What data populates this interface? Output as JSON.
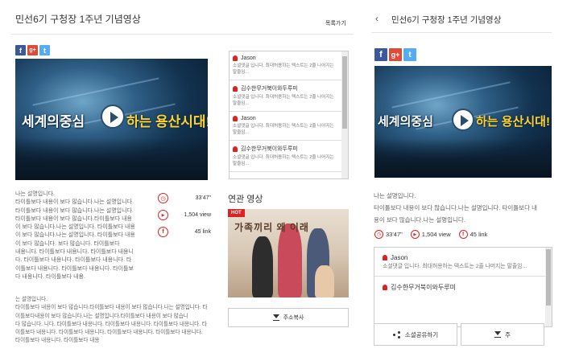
{
  "desktop": {
    "title": "민선6기 구청장 1주년 기념영상",
    "back_link": "목록가기",
    "sns": {
      "facebook": "f",
      "google": "g+",
      "twitter": "t"
    },
    "video": {
      "caption_left": "세계의중심",
      "caption_right": "하는 용산시대!"
    },
    "description_1": [
      "나는 설명입니다.",
      "타이틀보다 내용이 보다 많습니다.나는 설명입니다.",
      "타이틀보다 내용이 보다 많습니다.나는 설명입니다.",
      "타이틀보다 내용이 보다 많습니다.타이틀보다 내용",
      "이 보다 많습니다.나는 설명입니다. 타이틀보다 내용",
      "이 보다 많습니다.나는 설명입니다. 타이틀보다 내용",
      "이 보다 많습니다. 보다 많습니다. 타이틀보다",
      "내용니다. 타이틀보다 내용니다. 타이틀보다 내용니",
      "다. 타이틀보다 내용니다. 타이틀보다 내용니다. 타",
      "이틀보다 내용니다. 타이틀보다 내용니다. 타이틀보",
      "다 내용니다. 타이틀보다 내용."
    ],
    "description_2": [
      "는 설명입니다.",
      "타이틀보다 내용이 보다 많습니다.타이틀보다 내용이 보다 많습니다.나는 설명입니다. 타",
      "이틀보다내용이 보다 많습니다.나는 설명입니다.타이틀보다 내용이 보다 많습니",
      "다 많습니다. 니다. 타이틀보다 내용니다. 타이틀보다 내용니다. 타이틀보다 내용니다. 타",
      "이틀보다 내용니다. 타이틀보다 내용니다. 타이틀보다 내용니다. 타이틀보다 내용니다.",
      "타이틀보다 내용니다. 타이틀보다 내용"
    ],
    "stats": [
      {
        "icon": "clock-icon",
        "glyph": "◷",
        "value": "33'47\""
      },
      {
        "icon": "play-icon",
        "glyph": "▶",
        "value": "1,504 view"
      },
      {
        "icon": "facebook-icon",
        "glyph": "f",
        "value": "45 link"
      }
    ],
    "comments": [
      {
        "name": "Jason",
        "text": "소셜댓글 입니다. 최대허용하는 텍스트는 2줄 나어지는 말줄임..."
      },
      {
        "name": "김수한무거북이와두루미",
        "text": "소셜댓글 입니다. 최대허용하는 텍스트는 2줄 나어지는 말줄임..."
      },
      {
        "name": "Jason",
        "text": "소셜댓글 입니다. 최대허용하는 텍스트는 2줄 나어지는 말줄임..."
      },
      {
        "name": "김수한무거북이와두루미",
        "text": "소셜댓글 입니다. 최대허용하는 텍스트는 2줄 나어지는 말줄임..."
      }
    ],
    "related": {
      "title": "연관 영상",
      "badge": "HOT",
      "poster_title": "가족끼리 왜 이래"
    },
    "copy_address": "주소복사"
  },
  "mobile": {
    "back": "‹",
    "title": "민선6기 구청장 1주년 기념영상",
    "description": [
      "나는 설명입니다.",
      "타이틀보다 내용이 보다 많습니다.나는 설명입니다. 타이틀보다 내",
      "용이 보다 많습니다.나는 설명입니다."
    ],
    "stats": [
      {
        "icon": "clock-icon",
        "glyph": "◷",
        "value": "33'47\""
      },
      {
        "icon": "play-icon",
        "glyph": "▶",
        "value": "1,504 view"
      },
      {
        "icon": "facebook-icon",
        "glyph": "f",
        "value": "45 link"
      }
    ],
    "comments": [
      {
        "name": "Jason",
        "text": "소셜댓글 입니다. 최대허용하는 텍스트는 2줄 나머지는 말줄임..."
      },
      {
        "name": "김수한무거북이와두루미",
        "text": ""
      }
    ],
    "share_button": "소셜공유하기",
    "copy_button": "주"
  },
  "colors": {
    "accent": "#dd2222",
    "facebook": "#3b5998",
    "google": "#dd4b39",
    "twitter": "#55acee"
  }
}
